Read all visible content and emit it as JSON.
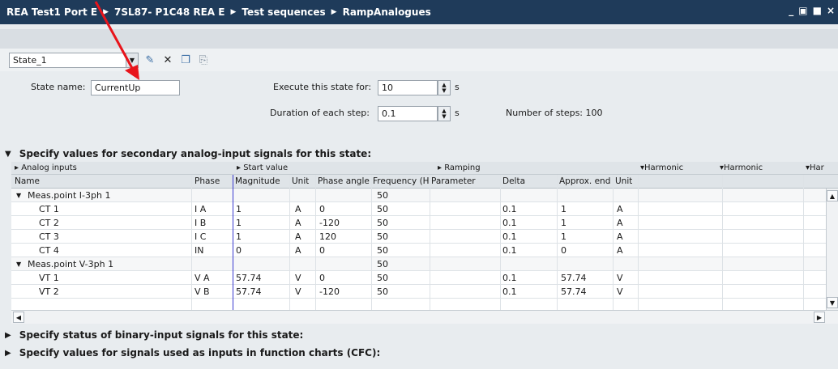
{
  "titlebar": {
    "crumbs": [
      "REA Test1 Port E",
      "7SL87- P1C48 REA E",
      "Test sequences",
      "RampAnalogues"
    ],
    "window_buttons": [
      "_",
      "▣",
      "■",
      "×"
    ]
  },
  "toolbar": {
    "state_value": "State_1",
    "icons": [
      "new-state-icon",
      "delete-icon",
      "copy-icon",
      "paste-icon"
    ]
  },
  "form": {
    "state_name_label": "State name:",
    "state_name_value": "CurrentUp",
    "execute_label": "Execute this state for:",
    "execute_value": "10",
    "execute_unit": "s",
    "duration_label": "Duration of each step:",
    "duration_value": "0.1",
    "duration_unit": "s",
    "steps_text": "Number of steps: 100"
  },
  "sections": {
    "analog": "Specify values for secondary analog-input signals for this state:",
    "binary": "Specify status of binary-input signals for this state:",
    "cfc": "Specify values for signals used as inputs in function charts (CFC):"
  },
  "grid": {
    "groups": [
      "Analog inputs",
      "Start value",
      "Ramping",
      "Harmonic",
      "Harmonic",
      "Har"
    ],
    "columns": [
      "Name",
      "Phase",
      "Magnitude",
      "Unit",
      "Phase angle (",
      "Frequency (H",
      "Parameter",
      "Delta",
      "Approx. end",
      "Unit"
    ],
    "rows": [
      {
        "name": "Meas.point I-3ph 1",
        "group": true,
        "phase": "",
        "mag": "",
        "unit": "",
        "angle": "",
        "freq": "50",
        "param": "",
        "delta": "",
        "end": "",
        "unit2": ""
      },
      {
        "name": "CT 1",
        "group": false,
        "phase": "I A",
        "mag": "1",
        "unit": "A",
        "angle": "0",
        "freq": "50",
        "param": "",
        "delta": "0.1",
        "end": "1",
        "unit2": "A"
      },
      {
        "name": "CT 2",
        "group": false,
        "phase": "I B",
        "mag": "1",
        "unit": "A",
        "angle": "-120",
        "freq": "50",
        "param": "",
        "delta": "0.1",
        "end": "1",
        "unit2": "A"
      },
      {
        "name": "CT 3",
        "group": false,
        "phase": "I C",
        "mag": "1",
        "unit": "A",
        "angle": "120",
        "freq": "50",
        "param": "",
        "delta": "0.1",
        "end": "1",
        "unit2": "A"
      },
      {
        "name": "CT 4",
        "group": false,
        "phase": "IN",
        "mag": "0",
        "unit": "A",
        "angle": "0",
        "freq": "50",
        "param": "",
        "delta": "0.1",
        "end": "0",
        "unit2": "A"
      },
      {
        "name": "Meas.point V-3ph 1",
        "group": true,
        "phase": "",
        "mag": "",
        "unit": "",
        "angle": "",
        "freq": "50",
        "param": "",
        "delta": "",
        "end": "",
        "unit2": ""
      },
      {
        "name": "VT 1",
        "group": false,
        "phase": "V A",
        "mag": "57.74",
        "unit": "V",
        "angle": "0",
        "freq": "50",
        "param": "",
        "delta": "0.1",
        "end": "57.74",
        "unit2": "V"
      },
      {
        "name": "VT 2",
        "group": false,
        "phase": "V B",
        "mag": "57.74",
        "unit": "V",
        "angle": "-120",
        "freq": "50",
        "param": "",
        "delta": "0.1",
        "end": "57.74",
        "unit2": "V"
      }
    ]
  },
  "colors": {
    "titlebar": "#1f3b5a",
    "annotation_arrow": "#e8141b",
    "magnitude_marker": "#3b3bd0"
  }
}
